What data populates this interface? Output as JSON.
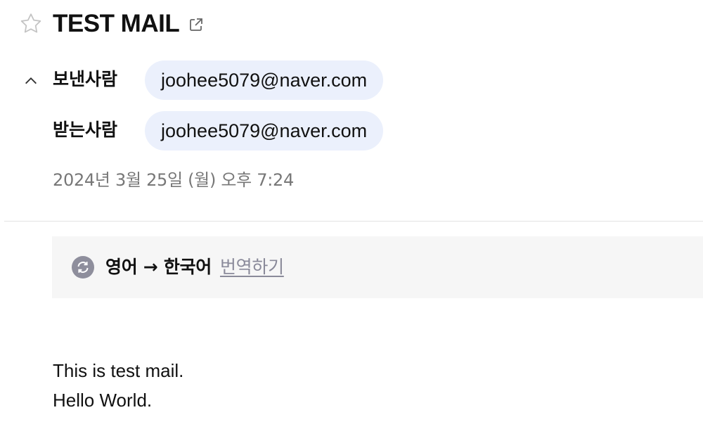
{
  "mail": {
    "subject": "TEST MAIL",
    "from_label": "보낸사람",
    "from_address": "joohee5079@naver.com",
    "to_label": "받는사람",
    "to_address": "joohee5079@naver.com",
    "date": "2024년 3월 25일 (월) 오후 7:24"
  },
  "translate": {
    "languages": "영어 → 한국어",
    "action_label": "번역하기"
  },
  "body": {
    "lines": [
      "This is test mail.",
      "Hello World."
    ]
  },
  "icons": {
    "star": "star-outline-icon",
    "popout": "open-in-new-window-icon",
    "collapse": "chevron-up-icon",
    "translate": "translate-refresh-icon"
  },
  "colors": {
    "chip_background": "#ebf0fc",
    "translate_bar_background": "#f6f6f6",
    "muted_text": "#777777",
    "translate_icon": "#8e8e9c"
  }
}
